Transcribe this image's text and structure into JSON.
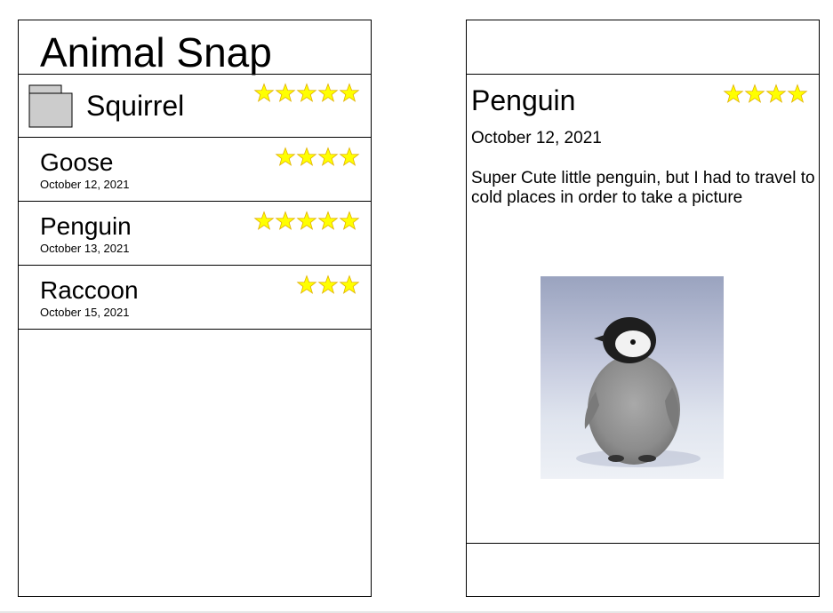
{
  "app": {
    "title": "Animal Snap"
  },
  "list": {
    "items": [
      {
        "name": "Squirrel",
        "date": "",
        "rating": 5,
        "has_thumbnail": true
      },
      {
        "name": "Goose",
        "date": "October 12, 2021",
        "rating": 4
      },
      {
        "name": "Penguin",
        "date": "October 13, 2021",
        "rating": 5
      },
      {
        "name": "Raccoon",
        "date": "October 15, 2021",
        "rating": 3
      }
    ]
  },
  "detail": {
    "name": "Penguin",
    "date": "October 12, 2021",
    "rating": 4,
    "description": "Super Cute little penguin, but I had to travel to cold places in order to take a picture",
    "photo": "penguin-chick-photo"
  },
  "colors": {
    "star_fill": "#ffff00",
    "star_stroke": "#e0b000",
    "thumbnail_fill": "#cccccc",
    "border": "#000000"
  }
}
